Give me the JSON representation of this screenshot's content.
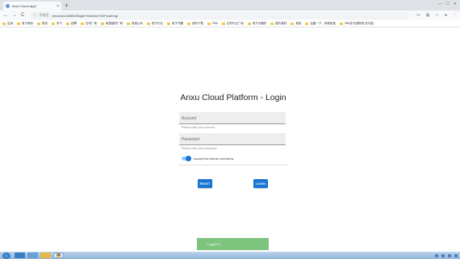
{
  "browser": {
    "tab_title": "Anxu Cloud Appl",
    "tab_close": "×",
    "new_tab": "+",
    "window_controls": [
      "—",
      "☐",
      "✕"
    ],
    "nav": {
      "back": "←",
      "forward": "→",
      "reload": "C"
    },
    "security_label": "不安全",
    "url": "anxucloud:8080/#/login?redirect=%2Fusermgr",
    "bookmarks": [
      "应用",
      "电子商务",
      "物流",
      "学习",
      "招聘",
      "石材厂商",
      "家居建材厂商",
      "快递公司",
      "电子行业",
      "电子书籍",
      "资料下载",
      "FBA",
      "石材行业厂商",
      "电子元器件",
      "图片素材",
      "其他",
      "百度一下，你就知道",
      "FBA亚马逊物流-亚马逊..."
    ]
  },
  "login": {
    "title": "Anxu Cloud Platform - Login",
    "account_label": "Account",
    "account_hint": "Please enter your account",
    "password_label": "Password",
    "password_hint": "Please enter your password",
    "terms_label": "I accept the license and terms",
    "terms_checked": true,
    "reset_label": "RESET",
    "login_label": "LOGIN"
  },
  "toast": {
    "message": "Logged in",
    "color": "#7ec37e"
  },
  "colors": {
    "primary": "#1976d2",
    "field_bg": "#eeeeee"
  }
}
